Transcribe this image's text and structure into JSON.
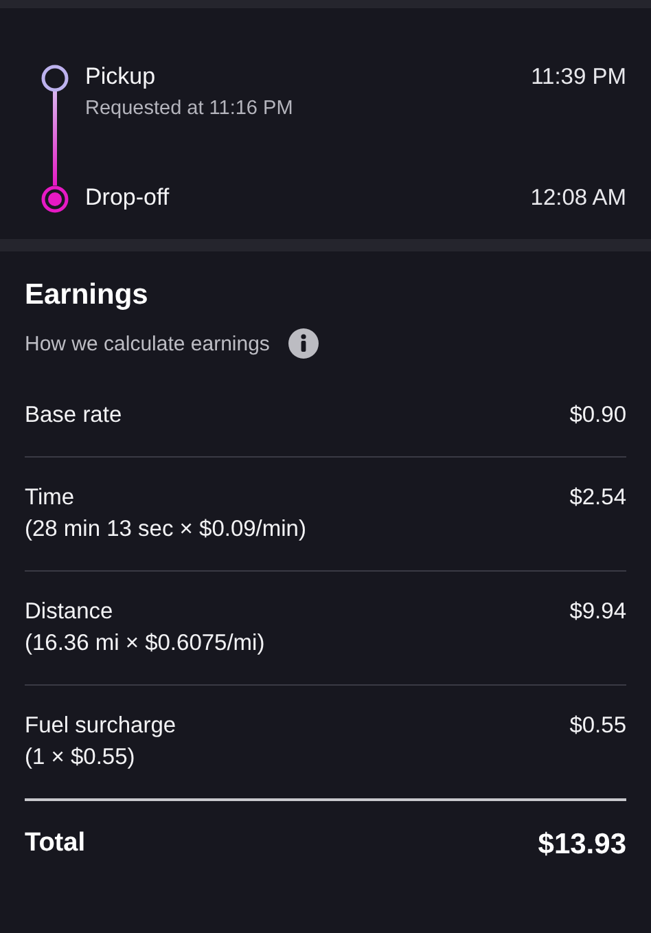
{
  "ride_summary": {
    "stops": [
      {
        "kind": "pickup",
        "label": "Pickup",
        "detail": "Requested at 11:16 PM",
        "time": "11:39 PM"
      },
      {
        "kind": "dropoff",
        "label": "Drop-off",
        "time": "12:08 AM"
      }
    ]
  },
  "earnings": {
    "title": "Earnings",
    "info_link": "How we calculate earnings",
    "items": [
      {
        "label": "Base rate",
        "amount": "$0.90"
      },
      {
        "label": "Time",
        "detail": "(28 min 13 sec × $0.09/min)",
        "amount": "$2.54"
      },
      {
        "label": "Distance",
        "detail": "(16.36 mi × $0.6075/mi)",
        "amount": "$9.94"
      },
      {
        "label": "Fuel surcharge",
        "detail": "(1 × $0.55)",
        "amount": "$0.55"
      }
    ],
    "total": {
      "label": "Total",
      "amount": "$13.93"
    }
  }
}
